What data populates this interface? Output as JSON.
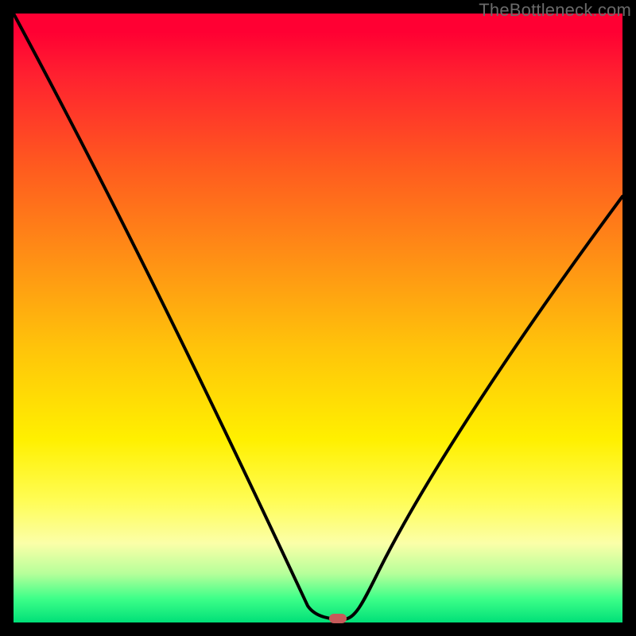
{
  "watermark": "TheBottleneck.com",
  "chart_data": {
    "type": "line",
    "title": "",
    "xlabel": "",
    "ylabel": "",
    "xlim": [
      0,
      1
    ],
    "ylim": [
      0,
      1
    ],
    "series": [
      {
        "name": "curve",
        "x": [
          0.0,
          0.05,
          0.1,
          0.15,
          0.2,
          0.25,
          0.3,
          0.35,
          0.4,
          0.45,
          0.48,
          0.51,
          0.54,
          0.57,
          0.6,
          0.65,
          0.7,
          0.75,
          0.8,
          0.85,
          0.9,
          0.95,
          1.0
        ],
        "y": [
          1.0,
          0.9,
          0.8,
          0.7,
          0.6,
          0.49,
          0.38,
          0.27,
          0.16,
          0.06,
          0.02,
          0.0,
          0.0,
          0.02,
          0.07,
          0.16,
          0.26,
          0.36,
          0.45,
          0.53,
          0.6,
          0.66,
          0.7
        ]
      }
    ],
    "marker": {
      "x": 0.525,
      "y": 0.003
    },
    "gradient_stops": [
      {
        "pos": 0.0,
        "color": "#ff0033"
      },
      {
        "pos": 0.25,
        "color": "#ff5a1f"
      },
      {
        "pos": 0.55,
        "color": "#ffc40a"
      },
      {
        "pos": 0.8,
        "color": "#fffd55"
      },
      {
        "pos": 0.92,
        "color": "#b6ff9a"
      },
      {
        "pos": 1.0,
        "color": "#00e078"
      }
    ]
  }
}
